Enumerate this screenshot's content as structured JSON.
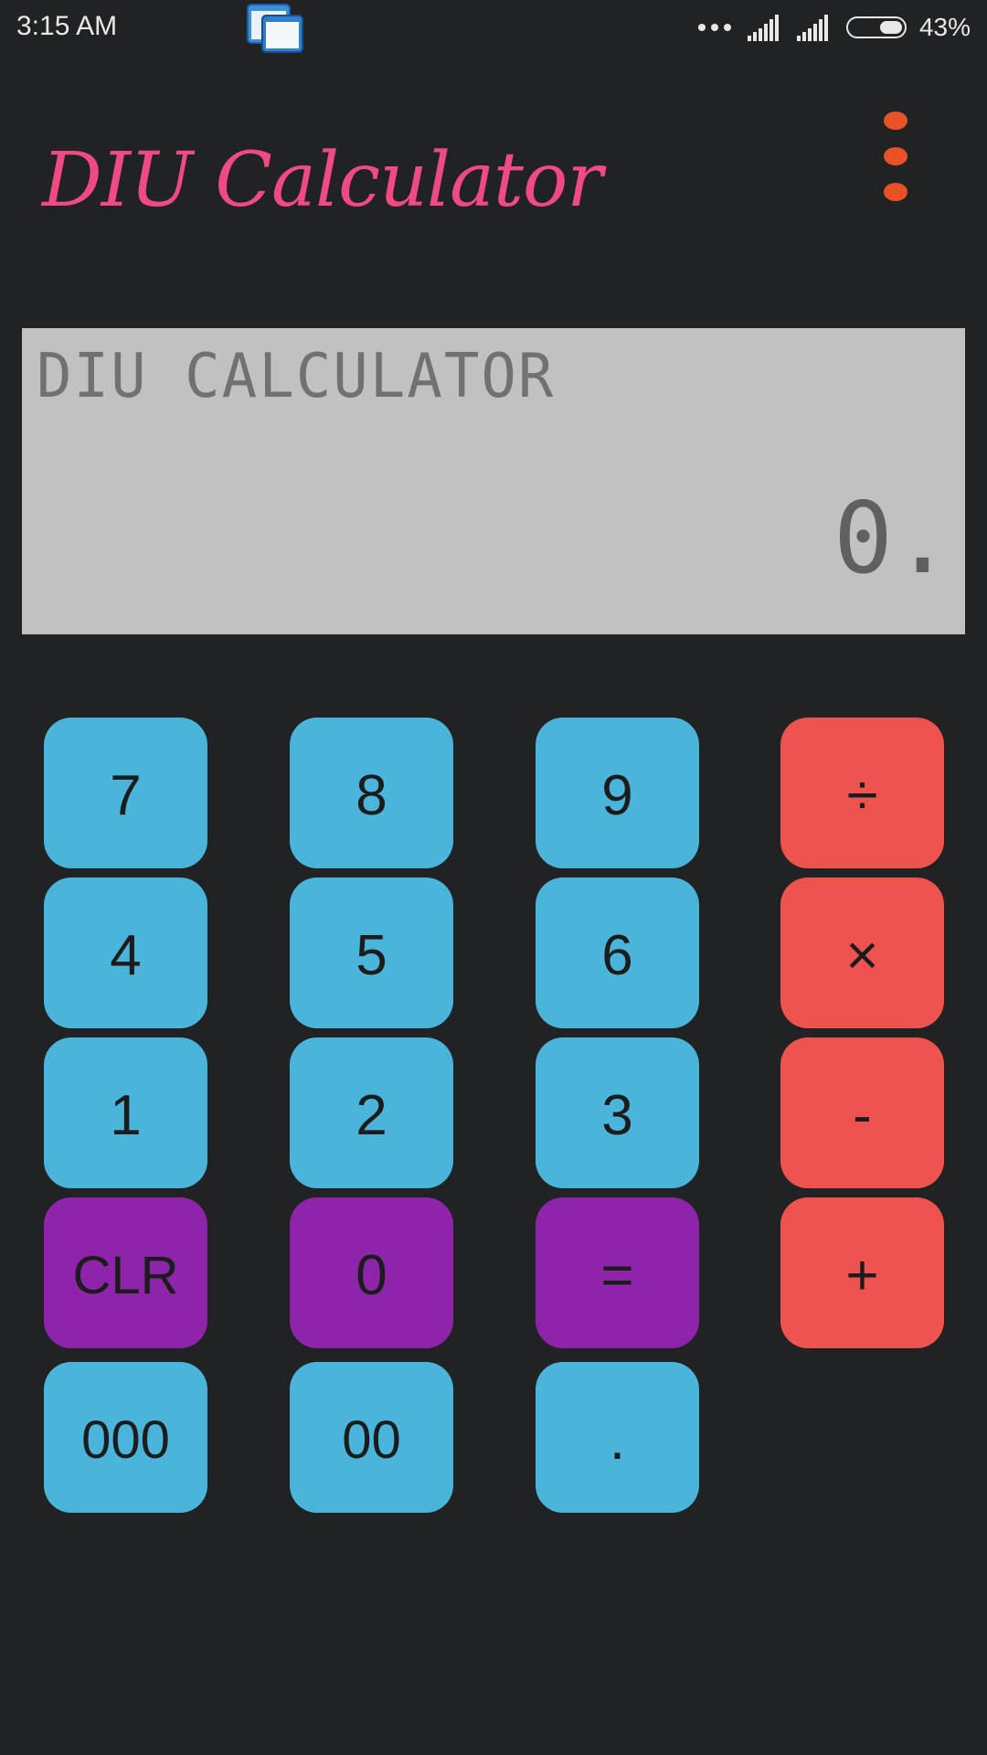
{
  "status_bar": {
    "time": "3:15 AM",
    "battery_percent": "43%",
    "battery_level": 0.43
  },
  "app": {
    "title": "DIU Calculator",
    "overflow_menu_icon": "more-vertical-icon",
    "accent_color": "#ef4a83",
    "menu_color": "#e85226"
  },
  "display": {
    "label": "DIU CALCULATOR",
    "value": "0."
  },
  "keypad": {
    "digit_color": "#4ab4da",
    "operator_color": "#ef5350",
    "action_color": "#8e24aa",
    "keys": {
      "seven": "7",
      "eight": "8",
      "nine": "9",
      "divide": "÷",
      "four": "4",
      "five": "5",
      "six": "6",
      "multiply": "×",
      "one": "1",
      "two": "2",
      "three": "3",
      "minus": "-",
      "clear": "CLR",
      "zero": "0",
      "equals": "=",
      "plus": "+",
      "triple_zero": "000",
      "double_zero": "00",
      "decimal": "."
    }
  }
}
